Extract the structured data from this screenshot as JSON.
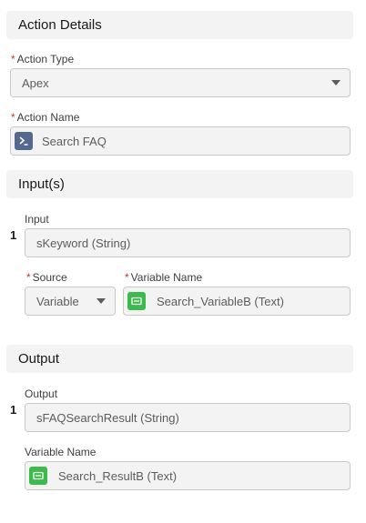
{
  "action_details": {
    "header": "Action Details",
    "action_type": {
      "label": "Action Type",
      "value": "Apex"
    },
    "action_name": {
      "label": "Action Name",
      "value": "Search FAQ"
    }
  },
  "inputs": {
    "header": "Input(s)",
    "index": "1",
    "input": {
      "label": "Input",
      "value": "sKeyword (String)"
    },
    "source": {
      "label": "Source",
      "value": "Variable"
    },
    "variable_name": {
      "label": "Variable Name",
      "value": "Search_VariableB (Text)"
    }
  },
  "output": {
    "header": "Output",
    "index": "1",
    "output_field": {
      "label": "Output",
      "value": "sFAQSearchResult (String)"
    },
    "variable_name": {
      "label": "Variable Name",
      "value": "Search_ResultB (Text)"
    }
  },
  "icons": {
    "apex": "apex-action-icon",
    "variable": "variable-icon",
    "dropdown": "chevron-down-icon"
  },
  "colors": {
    "required": "#c23934",
    "apex_icon": "#54698d",
    "variable_icon": "#3dba4c"
  }
}
